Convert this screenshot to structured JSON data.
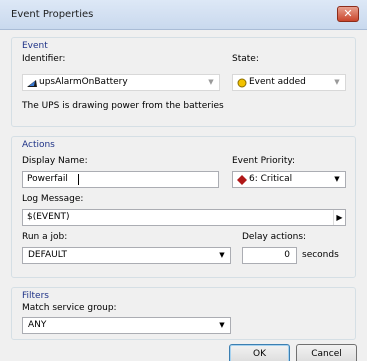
{
  "window": {
    "title": "Event Properties",
    "close_glyph": "✕"
  },
  "event_group": {
    "title": "Event",
    "identifier_label": "Identifier:",
    "identifier_value": "upsAlarmOnBattery",
    "state_label": "State:",
    "state_value": "Event added",
    "description": "The UPS is drawing power from the batteries"
  },
  "actions_group": {
    "title": "Actions",
    "display_name_label": "Display Name:",
    "display_name_value": "Powerfail",
    "priority_label": "Event Priority:",
    "priority_value": "6: Critical",
    "log_message_label": "Log Message:",
    "log_message_value": "$(EVENT)",
    "run_job_label": "Run a job:",
    "run_job_value": "DEFAULT",
    "delay_label": "Delay actions:",
    "delay_value": "0",
    "delay_unit": "seconds"
  },
  "filters_group": {
    "title": "Filters",
    "service_group_label": "Match service group:",
    "service_group_value": "ANY"
  },
  "buttons": {
    "ok": "OK",
    "cancel": "Cancel"
  },
  "colors": {
    "priority_critical": "#b01818",
    "state_added": "#e0b000",
    "group_title": "#1e3287"
  },
  "icons": {
    "identifier": "event-arrow-icon",
    "state": "yellow-dot-icon",
    "priority": "red-diamond-icon"
  }
}
